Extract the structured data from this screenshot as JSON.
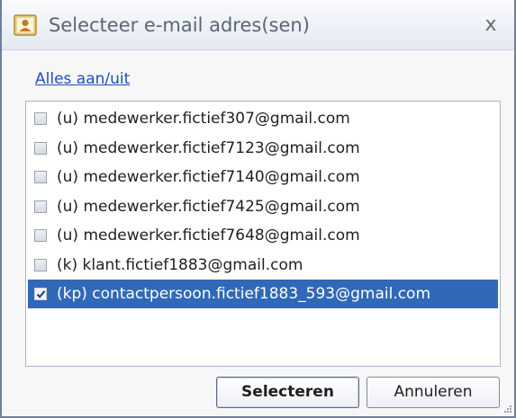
{
  "dialog": {
    "title": "Selecteer e-mail adres(sen)",
    "close_glyph": "x",
    "icon": "contact-card-icon"
  },
  "toggle_all_label": "Alles aan/uit",
  "list": {
    "items": [
      {
        "label": "(u) medewerker.fictief307@gmail.com",
        "checked": false,
        "selected": false
      },
      {
        "label": "(u) medewerker.fictief7123@gmail.com",
        "checked": false,
        "selected": false
      },
      {
        "label": "(u) medewerker.fictief7140@gmail.com",
        "checked": false,
        "selected": false
      },
      {
        "label": "(u) medewerker.fictief7425@gmail.com",
        "checked": false,
        "selected": false
      },
      {
        "label": "(u) medewerker.fictief7648@gmail.com",
        "checked": false,
        "selected": false
      },
      {
        "label": "(k) klant.fictief1883@gmail.com",
        "checked": false,
        "selected": false
      },
      {
        "label": "(kp) contactpersoon.fictief1883_593@gmail.com",
        "checked": true,
        "selected": true
      }
    ]
  },
  "buttons": {
    "select_label": "Selecteren",
    "cancel_label": "Annuleren"
  },
  "colors": {
    "selection": "#3069b7",
    "link": "#1f4fbf"
  }
}
